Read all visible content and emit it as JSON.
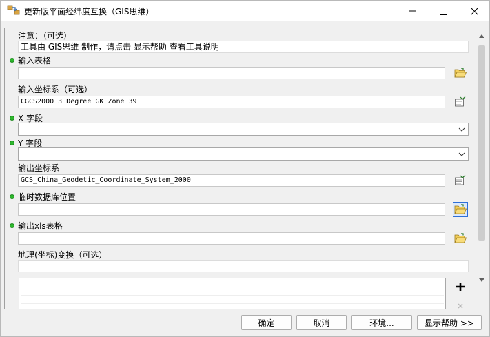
{
  "window": {
    "title": "更新版平面经纬度互换（GIS思维）"
  },
  "note": {
    "label": "注意：（可选）",
    "text": "工具由  GIS思维  制作，请点击  显示帮助  查看工具说明"
  },
  "params": [
    {
      "label": "输入表格",
      "required": true,
      "value": ""
    },
    {
      "label": "输入坐标系（可选）",
      "required": false,
      "value": "CGCS2000_3_Degree_GK_Zone_39"
    },
    {
      "label": "X 字段",
      "required": true,
      "value": ""
    },
    {
      "label": "Y 字段",
      "required": true,
      "value": ""
    },
    {
      "label": "输出坐标系",
      "required": false,
      "value": "GCS_China_Geodetic_Coordinate_System_2000"
    },
    {
      "label": "临时数据库位置",
      "required": true,
      "value": ""
    },
    {
      "label": "输出xls表格",
      "required": true,
      "value": ""
    },
    {
      "label": "地理(坐标)变换（可选）",
      "required": false,
      "value": ""
    }
  ],
  "buttons": {
    "ok": "确定",
    "cancel": "取消",
    "environments": "环境...",
    "show_help": "显示帮助 >>"
  },
  "icons": {
    "open_folder": "open-folder-icon",
    "spatial_reference": "spatial-reference-icon",
    "add": "plus-icon"
  },
  "colors": {
    "required_dot": "#2db82d",
    "active_button_border": "#2f6fd6"
  }
}
